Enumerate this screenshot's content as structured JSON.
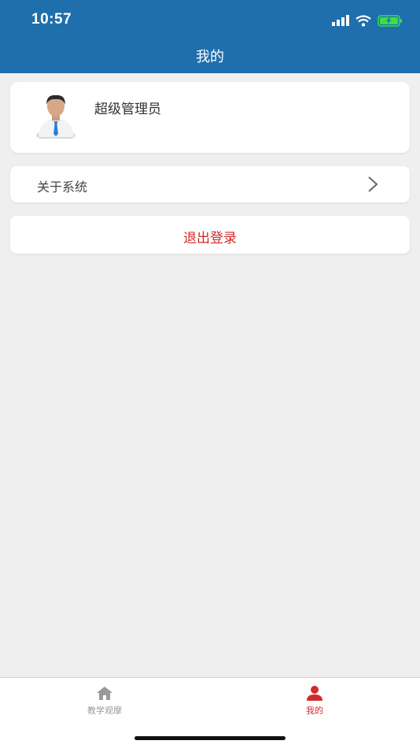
{
  "status_bar": {
    "time": "10:57"
  },
  "header": {
    "title": "我的"
  },
  "profile": {
    "name": "超级管理员"
  },
  "menu": {
    "about_label": "关于系统"
  },
  "logout": {
    "label": "退出登录"
  },
  "tabbar": {
    "tabs": [
      {
        "label": "教学观摩",
        "icon": "home-icon",
        "active": false
      },
      {
        "label": "我的",
        "icon": "person-icon",
        "active": true
      }
    ]
  },
  "colors": {
    "header": "#1f6fac",
    "accent": "#d42a2a",
    "background": "#efefef"
  }
}
